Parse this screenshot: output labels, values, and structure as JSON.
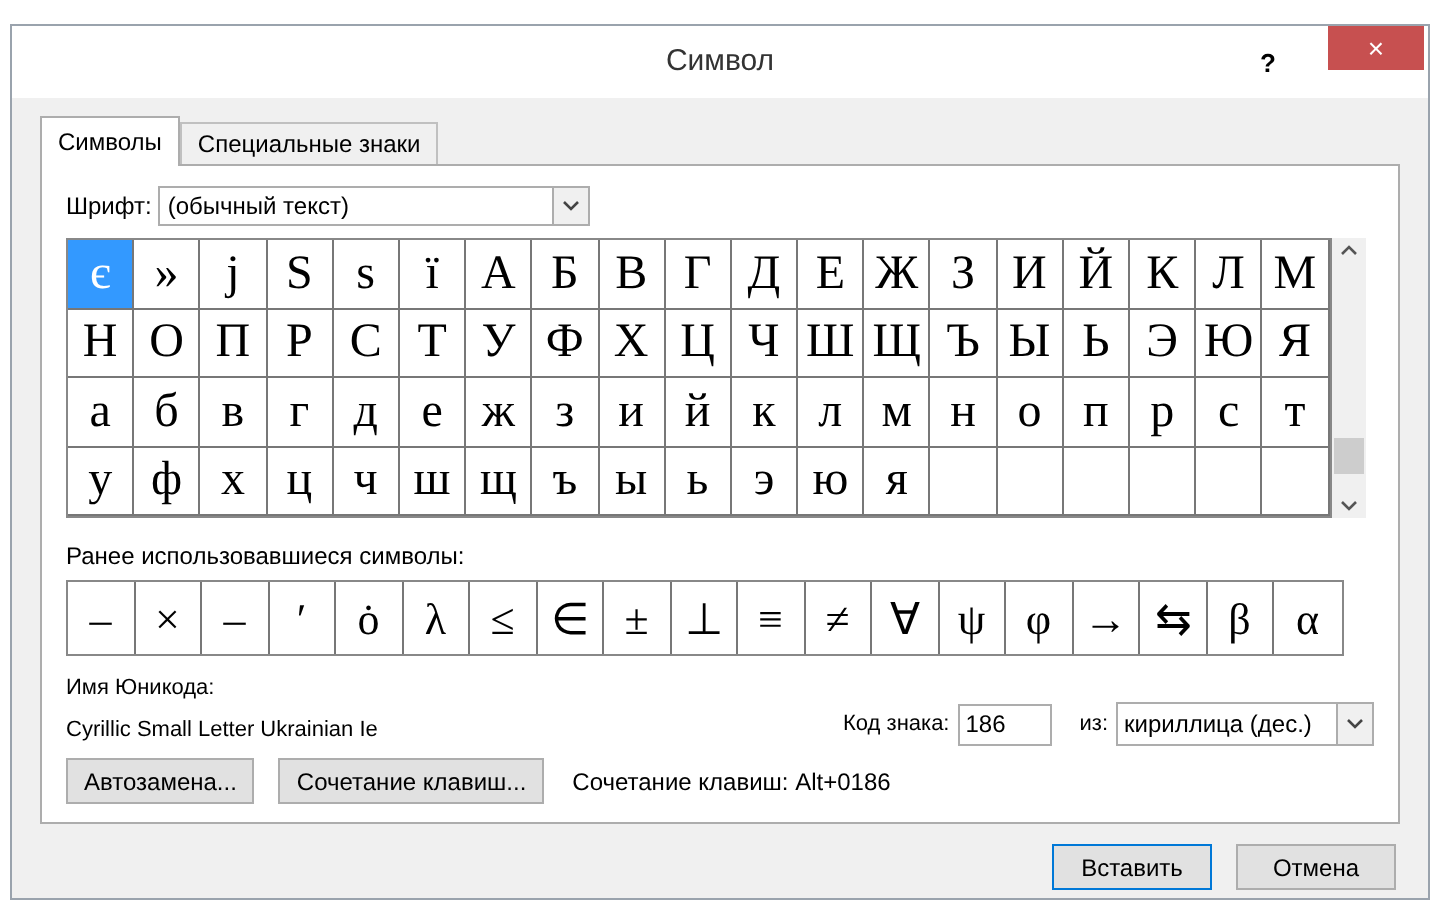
{
  "window": {
    "title": "Символ",
    "help": "?",
    "close": "×"
  },
  "tabs": [
    {
      "label": "Символы",
      "selected": true
    },
    {
      "label": "Специальные знаки",
      "selected": false
    }
  ],
  "font": {
    "label": "Шрифт:",
    "value": "(обычный текст)"
  },
  "grid": [
    {
      "char": "є",
      "selected": true
    },
    {
      "char": "»",
      "selected": false
    },
    {
      "char": "j",
      "selected": false
    },
    {
      "char": "S",
      "selected": false
    },
    {
      "char": "s",
      "selected": false
    },
    {
      "char": "ї",
      "selected": false
    },
    {
      "char": "А",
      "selected": false
    },
    {
      "char": "Б",
      "selected": false
    },
    {
      "char": "В",
      "selected": false
    },
    {
      "char": "Г",
      "selected": false
    },
    {
      "char": "Д",
      "selected": false
    },
    {
      "char": "Е",
      "selected": false
    },
    {
      "char": "Ж",
      "selected": false
    },
    {
      "char": "З",
      "selected": false
    },
    {
      "char": "И",
      "selected": false
    },
    {
      "char": "Й",
      "selected": false
    },
    {
      "char": "К",
      "selected": false
    },
    {
      "char": "Л",
      "selected": false
    },
    {
      "char": "М",
      "selected": false
    },
    {
      "char": "Н",
      "selected": false
    },
    {
      "char": "О",
      "selected": false
    },
    {
      "char": "П",
      "selected": false
    },
    {
      "char": "Р",
      "selected": false
    },
    {
      "char": "С",
      "selected": false
    },
    {
      "char": "Т",
      "selected": false
    },
    {
      "char": "У",
      "selected": false
    },
    {
      "char": "Ф",
      "selected": false
    },
    {
      "char": "Х",
      "selected": false
    },
    {
      "char": "Ц",
      "selected": false
    },
    {
      "char": "Ч",
      "selected": false
    },
    {
      "char": "Ш",
      "selected": false
    },
    {
      "char": "Щ",
      "selected": false
    },
    {
      "char": "Ъ",
      "selected": false
    },
    {
      "char": "Ы",
      "selected": false
    },
    {
      "char": "Ь",
      "selected": false
    },
    {
      "char": "Э",
      "selected": false
    },
    {
      "char": "Ю",
      "selected": false
    },
    {
      "char": "Я",
      "selected": false
    },
    {
      "char": "а",
      "selected": false
    },
    {
      "char": "б",
      "selected": false
    },
    {
      "char": "в",
      "selected": false
    },
    {
      "char": "г",
      "selected": false
    },
    {
      "char": "д",
      "selected": false
    },
    {
      "char": "е",
      "selected": false
    },
    {
      "char": "ж",
      "selected": false
    },
    {
      "char": "з",
      "selected": false
    },
    {
      "char": "и",
      "selected": false
    },
    {
      "char": "й",
      "selected": false
    },
    {
      "char": "к",
      "selected": false
    },
    {
      "char": "л",
      "selected": false
    },
    {
      "char": "м",
      "selected": false
    },
    {
      "char": "н",
      "selected": false
    },
    {
      "char": "о",
      "selected": false
    },
    {
      "char": "п",
      "selected": false
    },
    {
      "char": "р",
      "selected": false
    },
    {
      "char": "с",
      "selected": false
    },
    {
      "char": "т",
      "selected": false
    },
    {
      "char": "у",
      "selected": false
    },
    {
      "char": "ф",
      "selected": false
    },
    {
      "char": "х",
      "selected": false
    },
    {
      "char": "ц",
      "selected": false
    },
    {
      "char": "ч",
      "selected": false
    },
    {
      "char": "ш",
      "selected": false
    },
    {
      "char": "щ",
      "selected": false
    },
    {
      "char": "ъ",
      "selected": false
    },
    {
      "char": "ы",
      "selected": false
    },
    {
      "char": "ь",
      "selected": false
    },
    {
      "char": "э",
      "selected": false
    },
    {
      "char": "ю",
      "selected": false
    },
    {
      "char": "я",
      "selected": false
    }
  ],
  "recent": {
    "label": "Ранее использовавшиеся символы:",
    "symbols": [
      "–",
      "×",
      "–",
      "′",
      "ȯ",
      "λ",
      "≤",
      "∈",
      "±",
      "⊥",
      "≡",
      "≠",
      "∀",
      "ψ",
      "φ",
      "→",
      "⇆",
      "β",
      "α"
    ]
  },
  "unicode_name": {
    "label": "Имя Юникода:",
    "value": "Cyrillic Small Letter Ukrainian Ie"
  },
  "char_code": {
    "label": "Код знака:",
    "value": "186"
  },
  "from": {
    "label": "из:",
    "value": "кириллица (дес.)"
  },
  "buttons": [
    "Автозамена...",
    "Сочетание клавиш..."
  ],
  "shortcut": "Сочетание клавиш: Alt+0186",
  "footer_buttons": [
    {
      "label": "Вставить",
      "default": true
    },
    {
      "label": "Отмена",
      "default": false
    }
  ]
}
